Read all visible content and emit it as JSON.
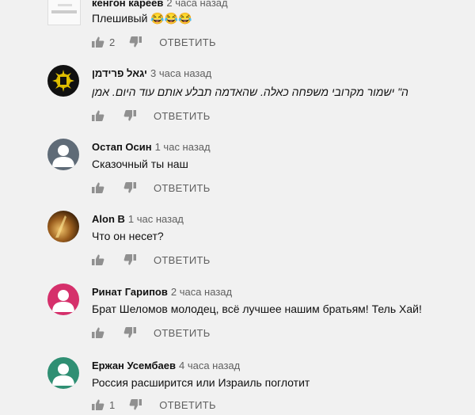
{
  "comments": [
    {
      "author": "кенгон кареев",
      "time": "2 часа назад",
      "text": "Плешивый 😂😂😂",
      "likes": "2",
      "reply_label": "ОТВЕТИТЬ"
    },
    {
      "author": "יגאל פרידמן",
      "time": "3 часа назад",
      "text": "ה\" ישמור מקרובי משפחה כאלה. שהאדמה תבלע אותם עוד היום. אמן",
      "likes": "",
      "reply_label": "ОТВЕТИТЬ"
    },
    {
      "author": "Остап Осин",
      "time": "1 час назад",
      "text": "Сказочный ты наш",
      "likes": "",
      "reply_label": "ОТВЕТИТЬ"
    },
    {
      "author": "Alon B",
      "time": "1 час назад",
      "text": "Что он несет?",
      "likes": "",
      "reply_label": "ОТВЕТИТЬ"
    },
    {
      "author": "Ринат Гарипов",
      "time": "2 часа назад",
      "text": "Брат Шеломов молодец, всё лучшее нашим братьям! Тель Хай!",
      "likes": "",
      "reply_label": "ОТВЕТИТЬ"
    },
    {
      "author": "Ержан Усембаев",
      "time": "4 часа назад",
      "text": "Россия расширится  или Израиль поглотит",
      "likes": "1",
      "reply_label": "ОТВЕТИТЬ"
    }
  ],
  "colors": {
    "background": "#f1f1f1",
    "icon": "#909090",
    "avatar_grey": "#5f6b77",
    "avatar_pink": "#d5306b",
    "avatar_teal": "#2f8f73"
  },
  "icons": [
    "thumb-up-icon",
    "thumb-down-icon"
  ]
}
